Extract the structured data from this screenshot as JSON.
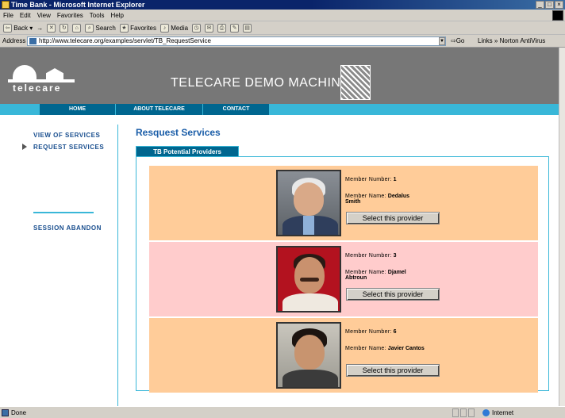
{
  "window": {
    "title": "Time Bank - Microsoft Internet Explorer",
    "controls": [
      "_",
      "□",
      "×"
    ]
  },
  "menubar": {
    "items": [
      "File",
      "Edit",
      "View",
      "Favorites",
      "Tools",
      "Help"
    ]
  },
  "toolbar": {
    "back": "Back",
    "forward": "→",
    "search": "Search",
    "favorites": "Favorites",
    "media": "Media"
  },
  "address": {
    "label": "Address",
    "url": "http://www.telecare.org/examples/servlet/TB_RequestService",
    "go": "Go",
    "links": "Links",
    "antivirus": "Norton AntiVirus"
  },
  "site": {
    "logo_text": "telecare",
    "title": "TELECARE DEMO MACHINE",
    "nav": [
      "HOME",
      "ABOUT TELECARE",
      "CONTACT"
    ]
  },
  "sidebar": {
    "items": [
      {
        "label": "VIEW OF SERVICES"
      },
      {
        "label": "REQUEST SERVICES"
      },
      {
        "label": "SESSION ABANDON"
      }
    ]
  },
  "main": {
    "title": "Resquest Services",
    "tab": "TB Potential Providers",
    "member_number_label": "Member Number:",
    "member_name_label": "Member Name:",
    "select_label": "Select this provider",
    "providers": [
      {
        "number": "1",
        "name_line1": "Dedalus",
        "name_line2": "Smith",
        "bg": "#ffcc99"
      },
      {
        "number": "3",
        "name_line1": "Djamel",
        "name_line2": "Abtroun",
        "bg": "#ffcccc"
      },
      {
        "number": "6",
        "name_line1": "Javier Cantos",
        "name_line2": "",
        "bg": "#ffcc99"
      }
    ]
  },
  "statusbar": {
    "status": "Done",
    "zone": "Internet"
  }
}
